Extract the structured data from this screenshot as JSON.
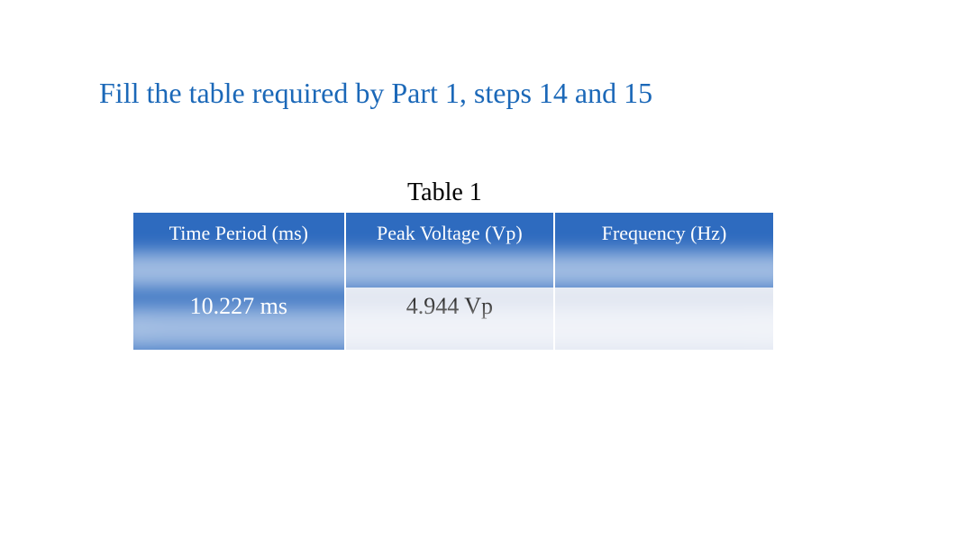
{
  "heading": "Fill the table required by Part 1, steps 14 and 15",
  "table": {
    "caption": "Table 1",
    "columns": [
      "Time Period (ms)",
      "Peak Voltage (Vp)",
      "Frequency (Hz)"
    ],
    "rows": [
      {
        "time_period": "10.227 ms",
        "peak_voltage": "4.944 Vp",
        "frequency": ""
      }
    ]
  },
  "chart_data": {
    "type": "table",
    "title": "Table 1",
    "columns": [
      "Time Period (ms)",
      "Peak Voltage (Vp)",
      "Frequency (Hz)"
    ],
    "rows": [
      [
        "10.227 ms",
        "4.944 Vp",
        ""
      ]
    ]
  }
}
